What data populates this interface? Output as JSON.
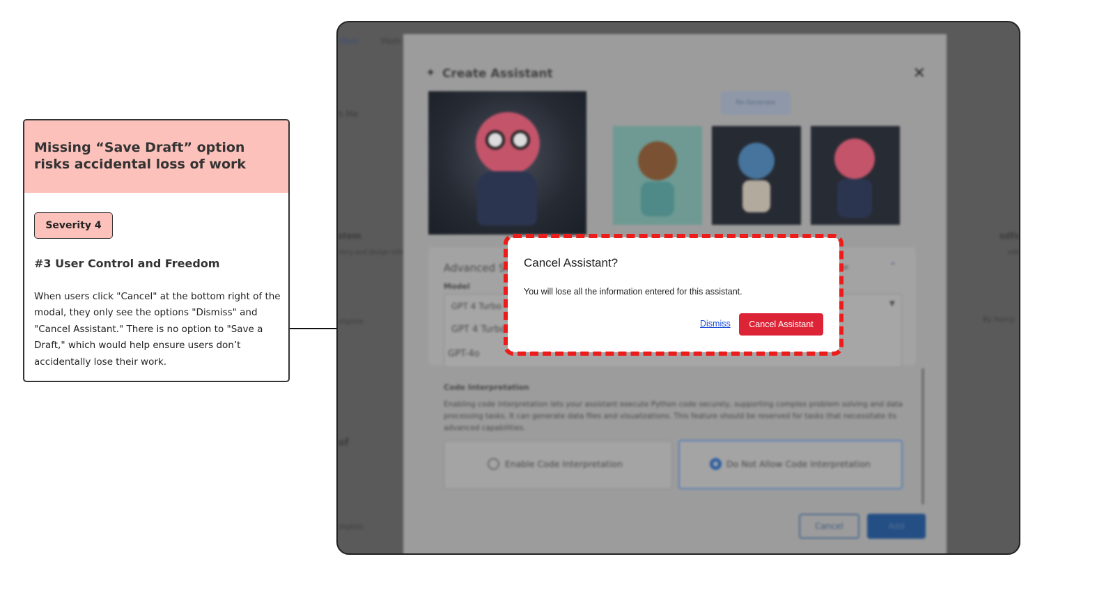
{
  "annotation": {
    "title": "Missing “Save Draft” option risks accidental loss of work",
    "severity": "Severity 4",
    "heuristic": "#3 User Control and Freedom",
    "body": "When users click \"Cancel\" at the bottom right of the modal, they only see the options \"Dismiss\" and \"Cancel Assistant.\" There is no option to \"Save a Draft,\" which would help ensure users don’t accidentally lose their work."
  },
  "background": {
    "nav_items": [
      "Hive",
      "Hom"
    ],
    "left_fragments": [
      "h Me",
      "stem",
      "rtery and design info",
      "ohphile",
      "of",
      "ohphile"
    ],
    "right_fragments": [
      "sdfs",
      "sdfs",
      "By Fanny"
    ]
  },
  "modal": {
    "title": "Create Assistant",
    "regenerate_label": "Re-Generate",
    "advanced_settings": "Advanced Settings",
    "usage_hint": "e use",
    "model_label": "Model",
    "model_options": [
      "GPT 4 Turbo",
      "GPT 4 Turbo",
      "GPT-4o"
    ],
    "code_interpretation_heading": "Code Interpretation",
    "code_interpretation_desc": "Enabling code interpretation lets your assistant execute Python code securely, supporting complex problem solving and data processing tasks. It can generate data files and visualizations. This feature should be reserved for tasks that necessitate its advanced capabilities.",
    "enable_option": "Enable Code Interpretation",
    "disallow_option": "Do Not Allow Code Interpretation",
    "cancel_label": "Cancel",
    "add_label": "Add"
  },
  "dialog": {
    "title": "Cancel Assistant?",
    "message": "You will lose all the information entered for this assistant.",
    "dismiss_label": "Dismiss",
    "confirm_label": "Cancel Assistant"
  },
  "colors": {
    "highlight": "#ee1b1b",
    "annotation_header": "#fdc1bb",
    "confirm_button": "#dc2436",
    "link": "#1d4ed8"
  }
}
